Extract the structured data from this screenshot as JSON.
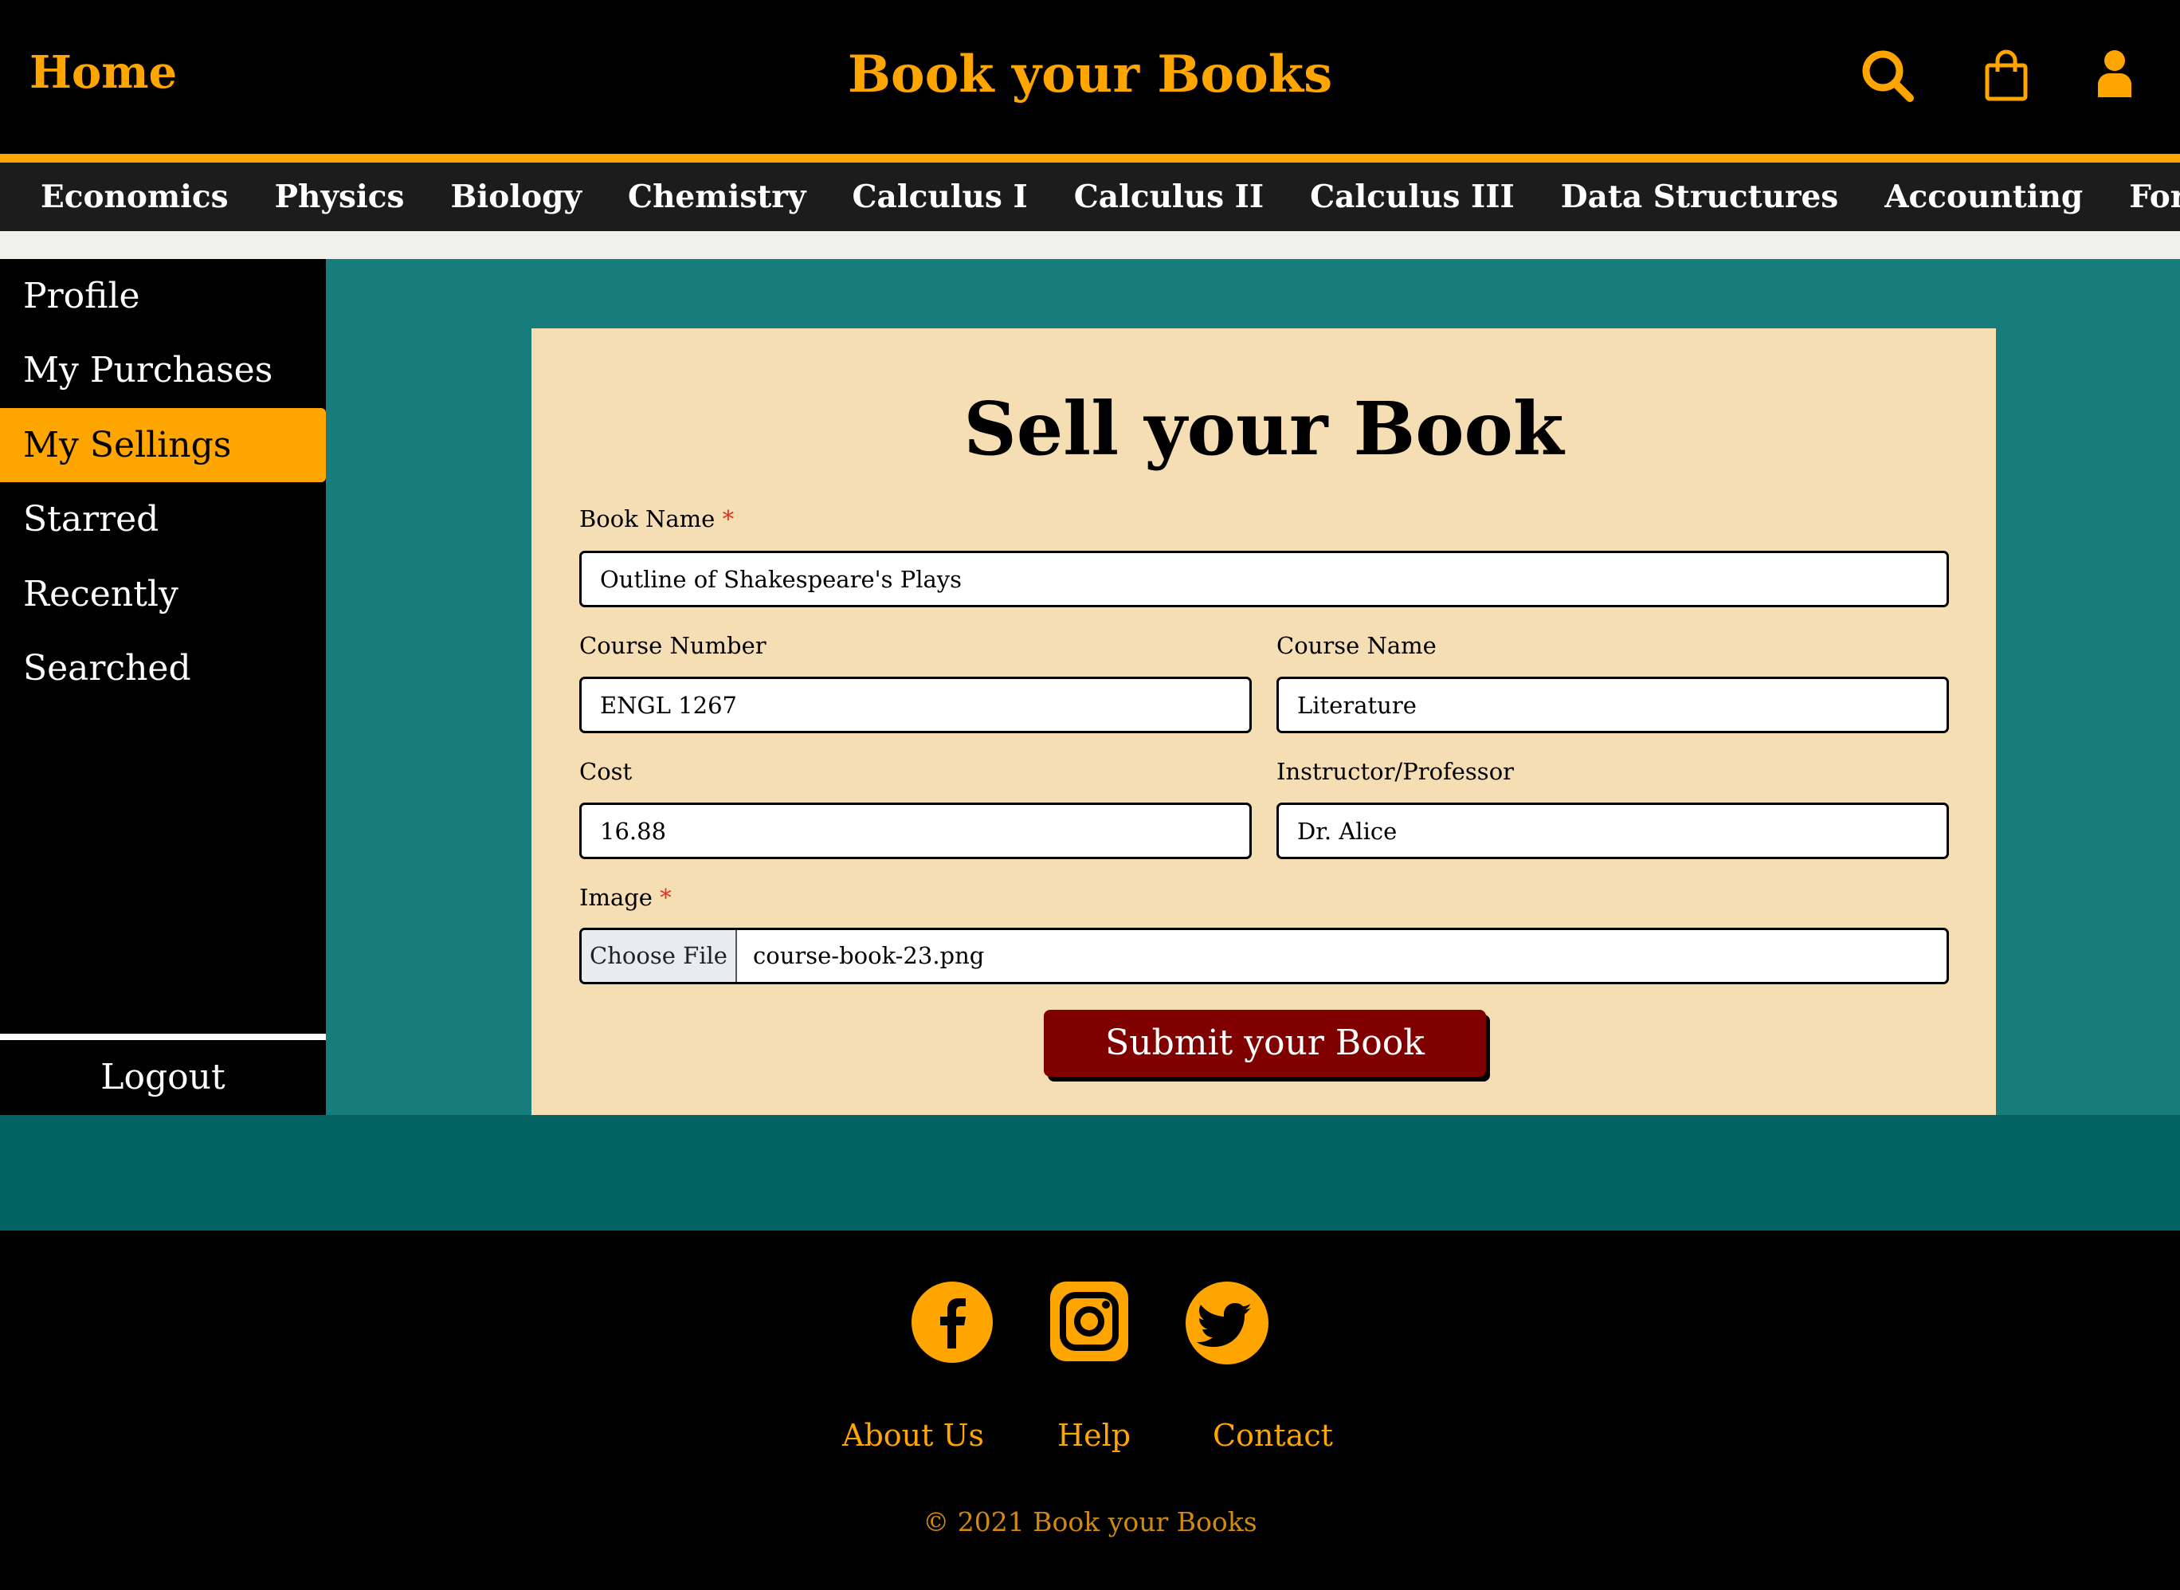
{
  "header": {
    "home": "Home",
    "title": "Book your Books",
    "icons": [
      "search-icon",
      "shopping-bag-icon",
      "user-icon"
    ],
    "accent": "#FFA500"
  },
  "categories": [
    "Economics",
    "Physics",
    "Biology",
    "Chemistry",
    "Calculus I",
    "Calculus II",
    "Calculus III",
    "Data Structures",
    "Accounting",
    "Forensic Science"
  ],
  "sidebar": {
    "items": [
      {
        "label": "Profile",
        "active": false
      },
      {
        "label": "My Purchases",
        "active": false
      },
      {
        "label": "My Sellings",
        "active": true
      },
      {
        "label": "Starred",
        "active": false
      },
      {
        "label": "Recently Searched",
        "active": false
      }
    ],
    "logout": "Logout"
  },
  "form": {
    "title": "Sell your Book",
    "required_mark": "*",
    "book_name": {
      "label": "Book Name",
      "value": "Outline of Shakespeare's Plays"
    },
    "course_number": {
      "label": "Course Number",
      "value": "ENGL 1267"
    },
    "course_name": {
      "label": "Course Name",
      "value": "Literature"
    },
    "cost": {
      "label": "Cost",
      "value": "16.88"
    },
    "instructor": {
      "label": "Instructor/Professor",
      "value": "Dr. Alice"
    },
    "image": {
      "label": "Image",
      "button": "Choose File",
      "file": "course-book-23.png"
    },
    "submit": "Submit your Book"
  },
  "footer": {
    "social": [
      "facebook-icon",
      "instagram-icon",
      "twitter-icon"
    ],
    "links": [
      "About Us",
      "Help",
      "Contact"
    ],
    "copyright": "© 2021 Book your Books"
  }
}
